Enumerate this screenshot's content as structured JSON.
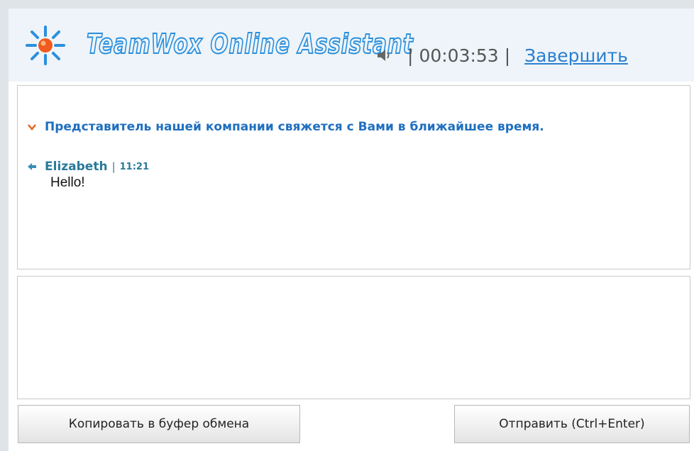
{
  "header": {
    "logo_text": "TeamWox Online Assistant",
    "timer": "00:03:53",
    "separator": "|",
    "finish_label": "Завершить",
    "icons": {
      "logo": "sun-spark-icon",
      "sound": "speaker-icon"
    }
  },
  "messages": {
    "system_message": "Представитель нашей компании свяжется с Вами в ближайшее время.",
    "items": [
      {
        "author": "Elizabeth",
        "separator": "|",
        "time": "11:21",
        "text": "Hello!"
      }
    ]
  },
  "input": {
    "value": "",
    "placeholder": ""
  },
  "buttons": {
    "copy_label": "Копировать в буфер обмена",
    "send_label": "Отправить (Ctrl+Enter)"
  },
  "colors": {
    "brand_blue": "#2a8fdc",
    "brand_orange": "#f05a1e",
    "link": "#2a7fd0",
    "author": "#2a7a9a",
    "system_text": "#1f6fbf"
  }
}
